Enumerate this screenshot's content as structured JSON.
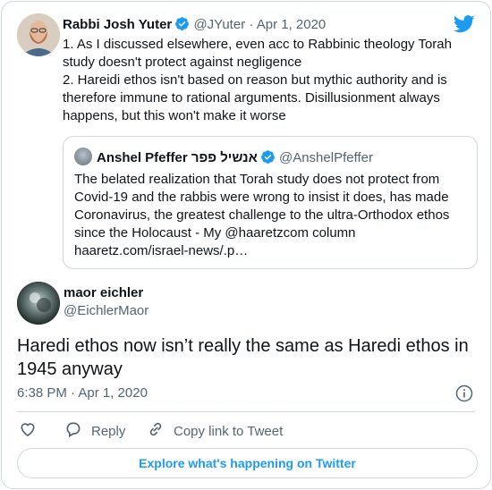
{
  "parent": {
    "name": "Rabbi Josh Yuter",
    "handle": "@JYuter",
    "separator": "·",
    "date": "Apr 1, 2020",
    "lines": [
      "1. As I discussed elsewhere, even acc to Rabbinic theology Torah study doesn't protect against negligence",
      "2. Hareidi ethos isn't based on reason but mythic authority and is therefore immune to rational arguments. Disillusionment always happens, but this won't make it worse"
    ]
  },
  "quote": {
    "name": "Anshel Pfeffer אנשיל פפר",
    "handle": "@AnshelPfeffer",
    "text": "The belated realization that Torah study does not protect from Covid-19 and the rabbis were wrong to insist it does, has made Coronavirus, the greatest challenge to the ultra-Orthodox ethos since the Holocaust - My @haaretzcom column haaretz.com/israel-news/.p…"
  },
  "reply": {
    "name": "maor eichler",
    "handle": "@EichlerMaor",
    "text": "Haredi ethos now isn’t really the same as Haredi ethos in 1945 anyway",
    "time": "6:38 PM · Apr 1, 2020"
  },
  "actions": {
    "reply_label": "Reply",
    "copy_label": "Copy link to Tweet"
  },
  "explore_label": "Explore what's happening on Twitter",
  "colors": {
    "accent": "#1d9bf0",
    "text": "#0f1419",
    "muted": "#536471",
    "border": "#cfd9de"
  }
}
